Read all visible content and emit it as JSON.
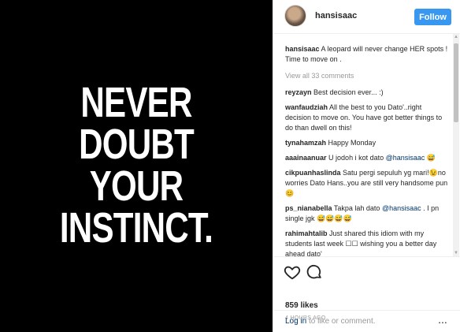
{
  "image": {
    "quote_lines": [
      "NEVER",
      "DOUBT",
      "YOUR",
      "INSTINCT."
    ]
  },
  "header": {
    "username": "hansisaac",
    "follow_label": "Follow"
  },
  "caption": {
    "username": "hansisaac",
    "text": "A leopard will never change HER spots ! Time to move on ."
  },
  "view_all_label": "View all 33 comments",
  "comments": [
    {
      "username": "reyzayn",
      "text": "Best decision ever... :)"
    },
    {
      "username": "wanfaudziah",
      "text": "All the best to you Dato'..right decision to move on. You have got better things to do than dwell on this!"
    },
    {
      "username": "tynahamzah",
      "text": "Happy Monday"
    },
    {
      "username": "aaainaanuar",
      "text": "U jodoh i kot dato",
      "mention": "@hansisaac",
      "after": " 😅"
    },
    {
      "username": "cikpuanhaslinda",
      "text": "Satu pergi sepuluh yg mari!😉no worries Dato Hans..you are still very handsome pun😊"
    },
    {
      "username": "ps_nianabella",
      "text": "Takpa lah dato",
      "mention": "@hansisaac",
      "after": " . I pn single jgk 😅😅😅😅"
    },
    {
      "username": "rahimahtalib",
      "text": "Just shared this idiom with my students last week ☐☐ wishing you a better day ahead dato'"
    }
  ],
  "likes": "859 likes",
  "timestamp": "4 HOURS AGO",
  "login": {
    "link": "Log in",
    "suffix": " to like or comment.",
    "more": "..."
  }
}
